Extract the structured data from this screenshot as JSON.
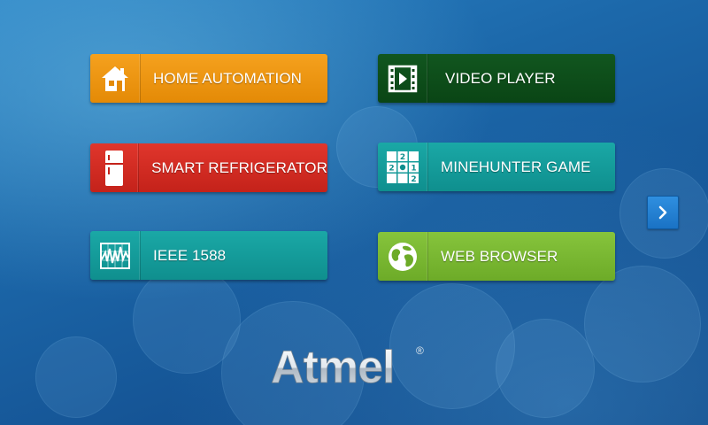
{
  "tiles": [
    {
      "label": "HOME AUTOMATION",
      "icon": "home-icon",
      "color": "#ee9610"
    },
    {
      "label": "VIDEO PLAYER",
      "icon": "video-film-icon",
      "color": "#0d4f1a"
    },
    {
      "label": "SMART REFRIGERATOR",
      "icon": "refrigerator-icon",
      "color": "#d22b22"
    },
    {
      "label": "MINEHUNTER GAME",
      "icon": "minesweeper-grid-icon",
      "color": "#16a09f"
    },
    {
      "label": "IEEE 1588",
      "icon": "oscilloscope-waveform-icon",
      "color": "#16a09f"
    },
    {
      "label": "WEB BROWSER",
      "icon": "globe-icon",
      "color": "#7ab834"
    }
  ],
  "navigation": {
    "next_icon": "chevron-right-icon"
  },
  "brand": {
    "logo_text": "Atmel",
    "registered_mark": "®"
  },
  "colors": {
    "background": "#1a5f9c",
    "next_button": "#2280d2"
  }
}
